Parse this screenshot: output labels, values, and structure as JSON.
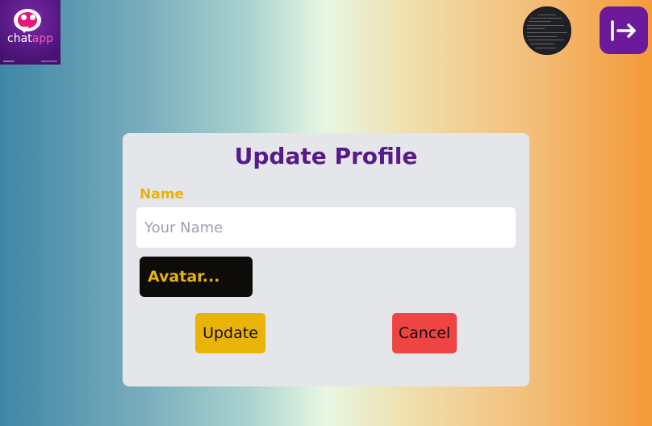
{
  "header": {
    "logo_text_main": "chat",
    "logo_text_accent": "app",
    "logout_icon": "logout-arrow-icon"
  },
  "profile_form": {
    "title": "Update Profile",
    "name_label": "Name",
    "name_value": "",
    "name_placeholder": "Your Name",
    "avatar_button": "Avatar...",
    "update_button": "Update",
    "cancel_button": "Cancel"
  },
  "colors": {
    "accent_purple": "#561a8a",
    "accent_yellow": "#eab308",
    "danger_red": "#ef4444",
    "card_bg": "#e5e6ea"
  }
}
